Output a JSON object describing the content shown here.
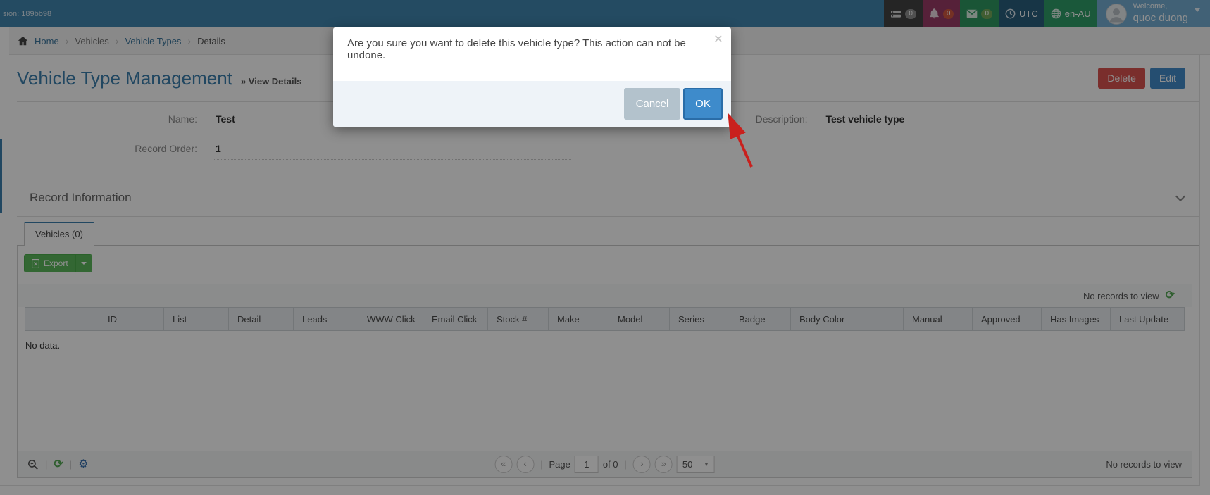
{
  "navbar": {
    "version": "sion: 189bb98",
    "widgets": [
      {
        "icon": "server-stack-icon",
        "count": "0"
      },
      {
        "icon": "bell-icon",
        "count": "0"
      },
      {
        "icon": "envelope-icon",
        "count": "0"
      }
    ],
    "timezone": "UTC",
    "locale": "en-AU",
    "welcome_line1": "Welcome,",
    "welcome_line2": "quoc duong"
  },
  "breadcrumb": {
    "home": "Home",
    "separator": "›",
    "items": [
      "Vehicles",
      "Vehicle Types",
      "Details"
    ]
  },
  "page": {
    "title": "Vehicle Type Management",
    "subtitle": "» View Details",
    "delete_label": "Delete",
    "edit_label": "Edit"
  },
  "form": {
    "name_label": "Name:",
    "name_value": "Test",
    "description_label": "Description:",
    "description_value": "Test vehicle type",
    "record_order_label": "Record Order:",
    "record_order_value": "1"
  },
  "section": {
    "title": "Record Information"
  },
  "tabs": {
    "vehicles": "Vehicles (0)"
  },
  "grid": {
    "export_label": "Export",
    "status_top": "No records to view",
    "columns": [
      "",
      "ID",
      "List",
      "Detail",
      "Leads",
      "WWW Click",
      "Email Click",
      "Stock #",
      "Make",
      "Model",
      "Series",
      "Badge",
      "Body Color",
      "Manual",
      "Approved",
      "Has Images",
      "Last Update"
    ],
    "empty_text": "No data.",
    "pager": {
      "page_label": "Page",
      "page_value": "1",
      "of_label": "of 0",
      "page_size": "50"
    },
    "status_bottom": "No records to view"
  },
  "modal": {
    "message": "Are you sure you want to delete this vehicle type? This action can not be undone.",
    "close": "×",
    "cancel_label": "Cancel",
    "ok_label": "OK"
  },
  "icons": {
    "first": "«",
    "prev": "‹",
    "next": "›",
    "last": "»",
    "caret_down": "▼",
    "refresh": "⟳",
    "gear": "⚙"
  },
  "colors": {
    "navbar": "#4186af",
    "title": "#3b7fad",
    "danger": "#d9534f",
    "primary": "#428bca",
    "success": "#5cb85c",
    "ok_button": "#3e8bcb",
    "cancel_button": "#b3c2cc",
    "modal_footer": "#eef3f8",
    "arrow": "#c9201d",
    "overlay": "rgba(0,0,0,0.44)"
  }
}
